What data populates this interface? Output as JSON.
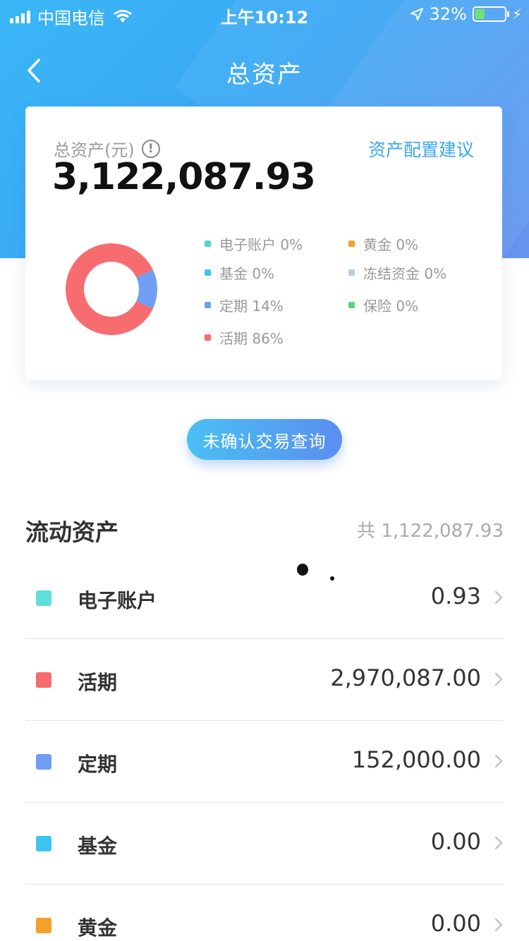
{
  "status_bar": {
    "carrier": "中国电信",
    "time": "上午10:12",
    "battery": "32%",
    "battery_level": 0.32
  },
  "nav": {
    "title": "总资产",
    "back_icon": "chevron-left-icon"
  },
  "summary": {
    "label": "总资产(元)",
    "info_icon": "info-icon",
    "total": "3,122,087.93",
    "advice_link": "资产配置建议"
  },
  "chart_data": {
    "type": "pie",
    "donut": true,
    "slices": [
      {
        "label": "电子账户",
        "value": 0,
        "color": "#4dd9d2"
      },
      {
        "label": "基金",
        "value": 0,
        "color": "#3ec4f0"
      },
      {
        "label": "定期",
        "value": 14,
        "color": "#6f9ef3"
      },
      {
        "label": "活期",
        "value": 86,
        "color": "#f76c6f"
      },
      {
        "label": "黄金",
        "value": 0,
        "color": "#f5a02a"
      },
      {
        "label": "冻结资金",
        "value": 0,
        "color": "#b8c9dc"
      },
      {
        "label": "保险",
        "value": 0,
        "color": "#5cd07a"
      }
    ]
  },
  "legend": [
    {
      "text": "电子账户 0%",
      "color": "#4dd9d2"
    },
    {
      "text": "黄金 0%",
      "color": "#f5a02a"
    },
    {
      "text": "基金 0%",
      "color": "#3ec4f0"
    },
    {
      "text": "冻结资金 0%",
      "color": "#b8c9dc"
    },
    {
      "text": "定期 14%",
      "color": "#6f9ef3"
    },
    {
      "text": "保险 0%",
      "color": "#5cd07a"
    },
    {
      "text": "活期 86%",
      "color": "#f76c6f"
    }
  ],
  "query_button": "未确认交易查询",
  "section": {
    "title": "流动资产",
    "total": "共 1,122,087.93"
  },
  "assets": [
    {
      "name": "电子账户",
      "value": "0.93",
      "color": "#5ee0da"
    },
    {
      "name": "活期",
      "value": "2,970,087.00",
      "color": "#f76c6f"
    },
    {
      "name": "定期",
      "value": "152,000.00",
      "color": "#6f9ef3"
    },
    {
      "name": "基金",
      "value": "0.00",
      "color": "#3ec4f0"
    },
    {
      "name": "黄金",
      "value": "0.00",
      "color": "#f5a02a"
    }
  ],
  "colors": {
    "header_start": "#3ab7f7",
    "header_end": "#5f8ff0",
    "link": "#3aa6f0"
  }
}
